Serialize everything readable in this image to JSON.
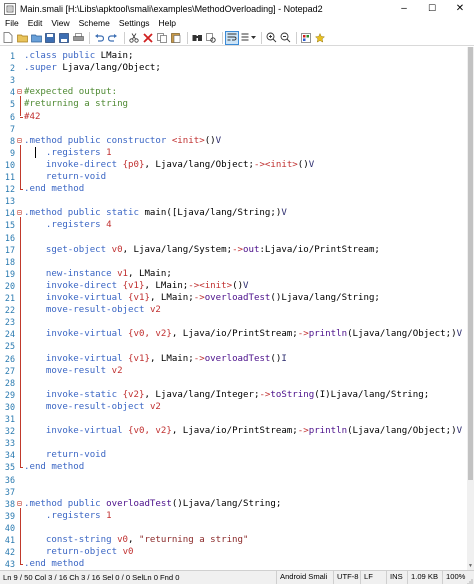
{
  "window": {
    "title": "Main.smali [H:\\Libs\\apktool\\smali\\examples\\MethodOverloading] - Notepad2",
    "minimize": "–",
    "maximize": "☐",
    "close": "✕"
  },
  "menu": [
    "File",
    "Edit",
    "View",
    "Scheme",
    "Settings",
    "Help"
  ],
  "toolbar": {
    "icons": [
      "new-file-icon",
      "open-file-icon",
      "browse-icon",
      "save-icon",
      "save-as-icon",
      "print-icon",
      "undo-icon",
      "redo-icon",
      "cut-icon",
      "delete-icon",
      "copy-icon",
      "paste-icon",
      "find-icon",
      "replace-icon",
      "word-wrap-icon",
      "view-options-icon",
      "zoom-in-icon",
      "zoom-out-icon",
      "scheme-icon",
      "favorites-icon"
    ]
  },
  "editor": {
    "language": "Smali",
    "lines": [
      {
        "n": "1",
        "tokens": [
          {
            "t": ".class public ",
            "c": "cd"
          },
          {
            "t": "LMain;",
            "c": "ctype"
          }
        ]
      },
      {
        "n": "2",
        "tokens": [
          {
            "t": ".super ",
            "c": "cd"
          },
          {
            "t": "Ljava/lang/Object;",
            "c": "ctype"
          }
        ]
      },
      {
        "n": "3",
        "tokens": []
      },
      {
        "n": "4",
        "tokens": [
          {
            "t": "#expected output:",
            "c": "cm"
          }
        ]
      },
      {
        "n": "5",
        "tokens": [
          {
            "t": "#returning a string",
            "c": "cm"
          }
        ]
      },
      {
        "n": "6",
        "tokens": [
          {
            "t": "#42",
            "c": "cr"
          }
        ]
      },
      {
        "n": "7",
        "tokens": []
      },
      {
        "n": "8",
        "tokens": [
          {
            "t": ".method public constructor ",
            "c": "cd"
          },
          {
            "t": "<init>",
            "c": "cp"
          },
          {
            "t": "()",
            "c": "ctype"
          },
          {
            "t": "V",
            "c": "cb"
          }
        ]
      },
      {
        "n": "9",
        "tokens": [
          {
            "t": "    .registers ",
            "c": "cd"
          },
          {
            "t": "1",
            "c": "cnum"
          }
        ]
      },
      {
        "n": "10",
        "tokens": [
          {
            "t": "    invoke-direct ",
            "c": "cd"
          },
          {
            "t": "{p0}",
            "c": "cnum"
          },
          {
            "t": ", Ljava/lang/Object;",
            "c": "ctype"
          },
          {
            "t": "->",
            "c": "cp"
          },
          {
            "t": "<init>",
            "c": "cp"
          },
          {
            "t": "()",
            "c": "ctype"
          },
          {
            "t": "V",
            "c": "cb"
          }
        ]
      },
      {
        "n": "11",
        "tokens": [
          {
            "t": "    return-void",
            "c": "cd"
          }
        ]
      },
      {
        "n": "12",
        "tokens": [
          {
            "t": ".end method",
            "c": "cd"
          }
        ]
      },
      {
        "n": "13",
        "tokens": []
      },
      {
        "n": "14",
        "tokens": [
          {
            "t": ".method public static ",
            "c": "cd"
          },
          {
            "t": "main([Ljava/lang/String;)",
            "c": "ctype"
          },
          {
            "t": "V",
            "c": "cb"
          }
        ]
      },
      {
        "n": "15",
        "tokens": [
          {
            "t": "    .registers ",
            "c": "cd"
          },
          {
            "t": "4",
            "c": "cnum"
          }
        ]
      },
      {
        "n": "16",
        "tokens": []
      },
      {
        "n": "17",
        "tokens": [
          {
            "t": "    sget-object ",
            "c": "cd"
          },
          {
            "t": "v0",
            "c": "cnum"
          },
          {
            "t": ", Ljava/lang/System;",
            "c": "ctype"
          },
          {
            "t": "->",
            "c": "cp"
          },
          {
            "t": "out",
            "c": "cf"
          },
          {
            "t": ":Ljava/io/PrintStream;",
            "c": "ctype"
          }
        ]
      },
      {
        "n": "18",
        "tokens": []
      },
      {
        "n": "19",
        "tokens": [
          {
            "t": "    new-instance ",
            "c": "cd"
          },
          {
            "t": "v1",
            "c": "cnum"
          },
          {
            "t": ", LMain;",
            "c": "ctype"
          }
        ]
      },
      {
        "n": "20",
        "tokens": [
          {
            "t": "    invoke-direct ",
            "c": "cd"
          },
          {
            "t": "{v1}",
            "c": "cnum"
          },
          {
            "t": ", LMain;",
            "c": "ctype"
          },
          {
            "t": "->",
            "c": "cp"
          },
          {
            "t": "<init>",
            "c": "cp"
          },
          {
            "t": "()",
            "c": "ctype"
          },
          {
            "t": "V",
            "c": "cb"
          }
        ]
      },
      {
        "n": "21",
        "tokens": [
          {
            "t": "    invoke-virtual ",
            "c": "cd"
          },
          {
            "t": "{v1}",
            "c": "cnum"
          },
          {
            "t": ", LMain;",
            "c": "ctype"
          },
          {
            "t": "->",
            "c": "cp"
          },
          {
            "t": "overloadTest",
            "c": "cf"
          },
          {
            "t": "()Ljava/lang/String;",
            "c": "ctype"
          }
        ]
      },
      {
        "n": "22",
        "tokens": [
          {
            "t": "    move-result-object ",
            "c": "cd"
          },
          {
            "t": "v2",
            "c": "cnum"
          }
        ]
      },
      {
        "n": "23",
        "tokens": []
      },
      {
        "n": "24",
        "tokens": [
          {
            "t": "    invoke-virtual ",
            "c": "cd"
          },
          {
            "t": "{v0, v2}",
            "c": "cnum"
          },
          {
            "t": ", Ljava/io/PrintStream;",
            "c": "ctype"
          },
          {
            "t": "->",
            "c": "cp"
          },
          {
            "t": "println",
            "c": "cf"
          },
          {
            "t": "(Ljava/lang/Object;)",
            "c": "ctype"
          },
          {
            "t": "V",
            "c": "cb"
          }
        ]
      },
      {
        "n": "25",
        "tokens": []
      },
      {
        "n": "26",
        "tokens": [
          {
            "t": "    invoke-virtual ",
            "c": "cd"
          },
          {
            "t": "{v1}",
            "c": "cnum"
          },
          {
            "t": ", LMain;",
            "c": "ctype"
          },
          {
            "t": "->",
            "c": "cp"
          },
          {
            "t": "overloadTest",
            "c": "cf"
          },
          {
            "t": "()",
            "c": "ctype"
          },
          {
            "t": "I",
            "c": "cb"
          }
        ]
      },
      {
        "n": "27",
        "tokens": [
          {
            "t": "    move-result ",
            "c": "cd"
          },
          {
            "t": "v2",
            "c": "cnum"
          }
        ]
      },
      {
        "n": "28",
        "tokens": []
      },
      {
        "n": "29",
        "tokens": [
          {
            "t": "    invoke-static ",
            "c": "cd"
          },
          {
            "t": "{v2}",
            "c": "cnum"
          },
          {
            "t": ", Ljava/lang/Integer;",
            "c": "ctype"
          },
          {
            "t": "->",
            "c": "cp"
          },
          {
            "t": "toString",
            "c": "cf"
          },
          {
            "t": "(I)Ljava/lang/String;",
            "c": "ctype"
          }
        ]
      },
      {
        "n": "30",
        "tokens": [
          {
            "t": "    move-result-object ",
            "c": "cd"
          },
          {
            "t": "v2",
            "c": "cnum"
          }
        ]
      },
      {
        "n": "31",
        "tokens": []
      },
      {
        "n": "32",
        "tokens": [
          {
            "t": "    invoke-virtual ",
            "c": "cd"
          },
          {
            "t": "{v0, v2}",
            "c": "cnum"
          },
          {
            "t": ", Ljava/io/PrintStream;",
            "c": "ctype"
          },
          {
            "t": "->",
            "c": "cp"
          },
          {
            "t": "println",
            "c": "cf"
          },
          {
            "t": "(Ljava/lang/Object;)",
            "c": "ctype"
          },
          {
            "t": "V",
            "c": "cb"
          }
        ]
      },
      {
        "n": "33",
        "tokens": []
      },
      {
        "n": "34",
        "tokens": [
          {
            "t": "    return-void",
            "c": "cd"
          }
        ]
      },
      {
        "n": "35",
        "tokens": [
          {
            "t": ".end method",
            "c": "cd"
          }
        ]
      },
      {
        "n": "36",
        "tokens": []
      },
      {
        "n": "37",
        "tokens": []
      },
      {
        "n": "38",
        "tokens": [
          {
            "t": ".method public ",
            "c": "cd"
          },
          {
            "t": "overloadTest",
            "c": "cf"
          },
          {
            "t": "()Ljava/lang/String;",
            "c": "ctype"
          }
        ]
      },
      {
        "n": "39",
        "tokens": [
          {
            "t": "    .registers ",
            "c": "cd"
          },
          {
            "t": "1",
            "c": "cnum"
          }
        ]
      },
      {
        "n": "40",
        "tokens": []
      },
      {
        "n": "41",
        "tokens": [
          {
            "t": "    const-string ",
            "c": "cd"
          },
          {
            "t": "v0",
            "c": "cnum"
          },
          {
            "t": ", ",
            "c": "ctype"
          },
          {
            "t": "\"returning a string\"",
            "c": "cstr"
          }
        ]
      },
      {
        "n": "42",
        "tokens": [
          {
            "t": "    return-object ",
            "c": "cd"
          },
          {
            "t": "v0",
            "c": "cnum"
          }
        ]
      },
      {
        "n": "43",
        "tokens": [
          {
            "t": ".end method",
            "c": "cd"
          }
        ]
      }
    ]
  },
  "status": {
    "position": "Ln 9 / 50  Col 3 / 16  Ch 3 / 16  Sel 0 / 0  SelLn 0  Fnd 0",
    "scheme": "Android Smali",
    "encoding": "UTF-8",
    "eol": "LF",
    "mode": "INS",
    "size": "1.09 KB",
    "zoom": "100%"
  }
}
